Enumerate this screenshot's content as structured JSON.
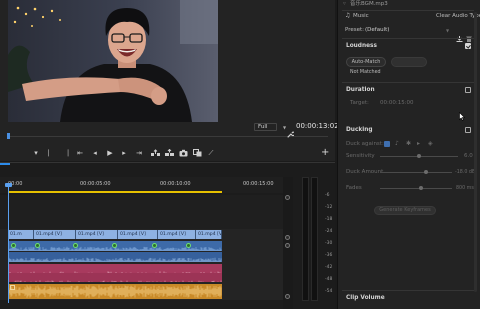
{
  "monitor": {
    "zoom": "Full",
    "timecode": "00:00:13:02"
  },
  "timeline": {
    "ruler": [
      "00:00",
      "00:00:05:00",
      "00:00:10:00",
      "00:00:15:00"
    ],
    "video_clips": [
      "01.m",
      "01.mp4 [V]",
      "01.mp4 [V]",
      "01.mp4 [V]",
      "01.mp4 [V]",
      "01.mp4 [V]"
    ],
    "meter_scale": [
      "-6",
      "-12",
      "-18",
      "-24",
      "-30",
      "-36",
      "-42",
      "-48",
      "-54"
    ]
  },
  "essential_sound": {
    "file_name": "音乐BGM.mp3",
    "audio_type": "Music",
    "clear_type": "Clear Audio Type",
    "preset_label": "Preset:",
    "preset_value": "(Default)",
    "loudness": {
      "title": "Loudness",
      "enabled": true,
      "auto_match": "Auto-Match",
      "status": "Not Matched"
    },
    "duration": {
      "title": "Duration",
      "enabled": false,
      "target_label": "Target:",
      "target_value": "00:00:15:00"
    },
    "ducking": {
      "title": "Ducking",
      "enabled": false,
      "duck_against": "Duck against:",
      "sensitivity": "Sensitivity",
      "sensitivity_value": "6.0",
      "duck_amount": "Duck Amount",
      "duck_amount_value": "-18.0 dB",
      "fades": "Fades",
      "fades_value": "800 ms",
      "generate": "Generate Keyframes"
    },
    "clip_volume": "Clip Volume"
  },
  "icons": {
    "tab": "audio-file-icon",
    "type": "music-note-icon",
    "wrench": "wrench-icon",
    "add": "plus-icon",
    "save_preset": "save-icon",
    "delete_preset": "trash-icon",
    "cursor": "mouse-cursor"
  },
  "colors": {
    "accent": "#2d8ceb",
    "work_area": "#e6c000",
    "video_clip": "#8eb1e2",
    "audio_dialogue": "#3d6aa8",
    "audio_sfx": "#a83a5e",
    "audio_music": "#c98a28",
    "fx_badge": "#6fe06f"
  }
}
